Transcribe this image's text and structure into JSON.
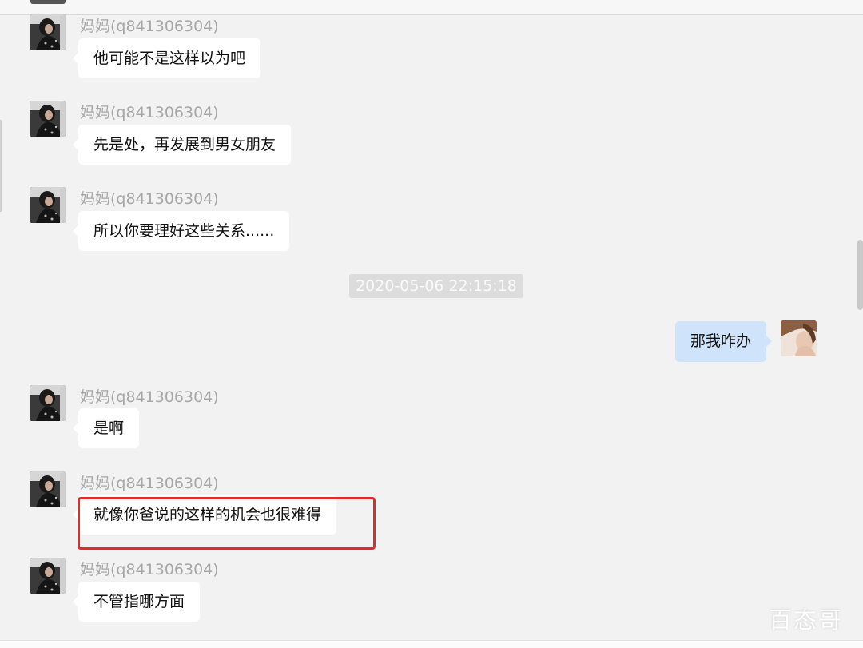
{
  "colors": {
    "background": "#f2f2f3",
    "incoming_bubble": "#ffffff",
    "outgoing_bubble": "#cfe4fb",
    "sender_text": "#a7a7a7",
    "timestamp_bg": "#dcdcdc",
    "highlight": "#e12a2a"
  },
  "messages": [
    {
      "sender": "妈妈(q841306304)",
      "text": "他可能不是这样以为吧"
    },
    {
      "sender": "妈妈(q841306304)",
      "text": "先是处，再发展到男女朋友"
    },
    {
      "sender": "妈妈(q841306304)",
      "text": "所以你要理好这些关系......"
    }
  ],
  "timestamp": "2020-05-06 22:15:18",
  "self_message": {
    "text": "那我咋办"
  },
  "messages_after": [
    {
      "sender": "妈妈(q841306304)",
      "text": "是啊"
    },
    {
      "sender": "妈妈(q841306304)",
      "text": "就像你爸说的这样的机会也很难得"
    },
    {
      "sender": "妈妈(q841306304)",
      "text": "不管指哪方面"
    }
  ],
  "watermark": "百态哥",
  "icons": {
    "contact_avatar": "contact-avatar-icon",
    "self_avatar": "self-avatar-icon"
  }
}
